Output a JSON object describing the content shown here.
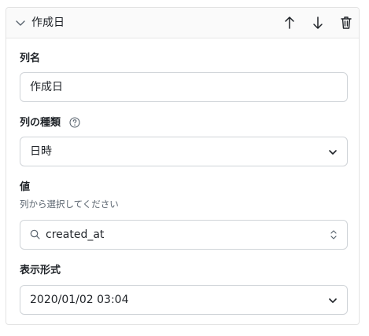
{
  "header": {
    "title": "作成日",
    "icons": {
      "collapse": "chevron-down-icon",
      "move_up": "arrow-up-icon",
      "move_down": "arrow-down-icon",
      "delete": "trash-icon"
    }
  },
  "column_name": {
    "label": "列名",
    "value": "作成日"
  },
  "column_type": {
    "label": "列の種類",
    "help_icon": "question-circle-icon",
    "selected": "日時"
  },
  "value_field": {
    "label": "値",
    "description": "列から選択してください",
    "selected": "created_at",
    "search_icon": "search-icon"
  },
  "display_format": {
    "label": "表示形式",
    "selected": "2020/01/02 03:04"
  },
  "colors": {
    "border": "#d0d4d8",
    "header_bg": "#fafafa",
    "text": "#1f2328",
    "muted": "#59636e"
  }
}
